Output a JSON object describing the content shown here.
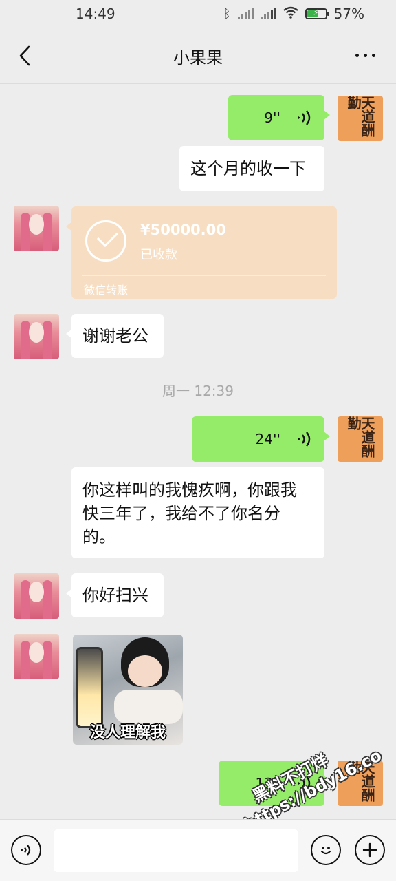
{
  "status_bar": {
    "time": "14:49",
    "battery": "57%",
    "battery_level": 0.57,
    "icons": [
      "bluetooth-icon",
      "signal-icon",
      "signal-icon",
      "wifi-icon",
      "battery-icon"
    ]
  },
  "nav": {
    "title": "小果果",
    "back_icon": "chevron-left-icon",
    "more_icon": "more-horizontal-icon"
  },
  "messages": {
    "m1": {
      "sender": "self",
      "type": "voice",
      "duration": "9''"
    },
    "m2": {
      "sender": "self",
      "type": "text",
      "text": "这个月的收一下"
    },
    "m3": {
      "sender": "contact",
      "type": "transfer",
      "amount": "¥50000.00",
      "status": "已收款",
      "label": "微信转账"
    },
    "m4": {
      "sender": "contact",
      "type": "text",
      "text": "谢谢老公"
    },
    "timestamp": "周一 12:39",
    "m5": {
      "sender": "self",
      "type": "voice",
      "duration": "24''"
    },
    "m6": {
      "sender": "contact",
      "type": "text",
      "line1": "你这样叫的我愧疚啊，你跟我",
      "line2": "快三年了，我给不了你名分",
      "line3": "的。"
    },
    "m7": {
      "sender": "contact",
      "type": "text",
      "text": "你好扫兴"
    },
    "m8": {
      "sender": "contact",
      "type": "sticker",
      "caption": "没人理解我"
    },
    "m9": {
      "sender": "self",
      "type": "voice",
      "duration": "13''"
    }
  },
  "avatar_self_text": "天道酬勤",
  "watermark": {
    "line1": "黑料不打烊",
    "line2": "https://bdy16.co"
  },
  "input_bar": {
    "voice_icon": "voice-input-icon",
    "emoji_icon": "emoji-icon",
    "plus_icon": "plus-icon"
  },
  "colors": {
    "background": "#ededed",
    "self_bubble": "#95ec69",
    "contact_bubble": "#ffffff",
    "transfer_card": "#f7dec3"
  }
}
